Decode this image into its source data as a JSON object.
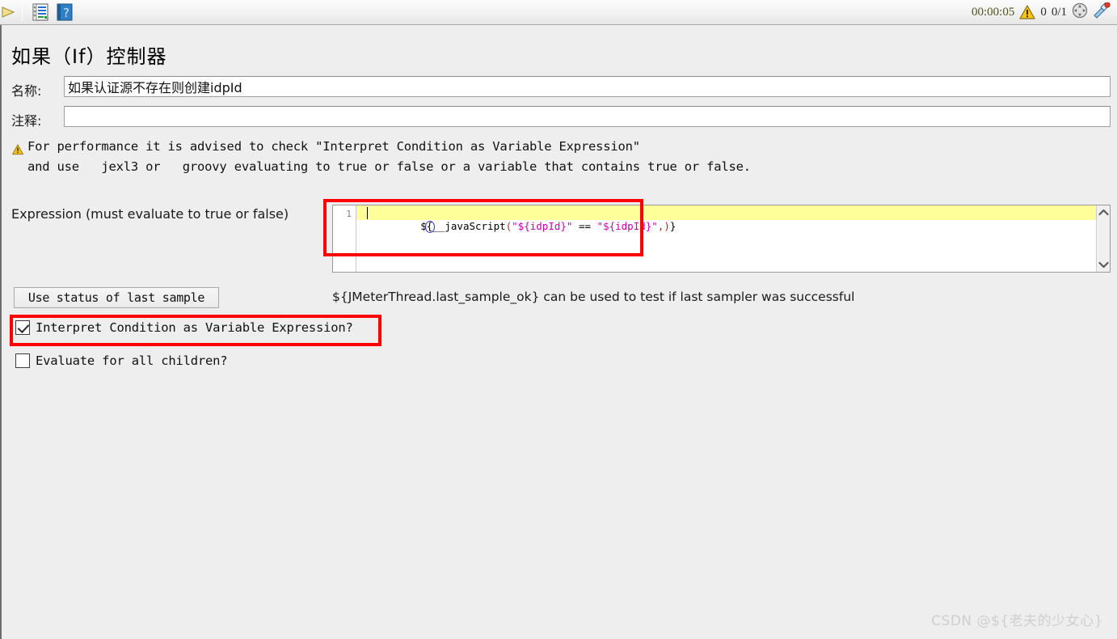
{
  "toolbar": {
    "icons": [
      {
        "name": "run-start-icon",
        "glyph": "start"
      },
      {
        "name": "function-helper-icon",
        "glyph": "notes"
      },
      {
        "name": "help-icon",
        "glyph": "question"
      }
    ],
    "elapsed_time": "00:00:05",
    "warning_count": "0",
    "thread_counts": "0/1",
    "warning_icon_name": "warning-triangle-icon",
    "clear_icon_name": "clear-all-icon",
    "brush_icon_name": "clear-gui-icon"
  },
  "page": {
    "title": "如果（If）控制器"
  },
  "form": {
    "name_label": "名称:",
    "name_value": "如果认证源不存在则创建idpId",
    "comment_label": "注释:",
    "comment_value": "",
    "comment_placeholder": ""
  },
  "warning": {
    "icon_name": "warning-triangle-icon",
    "line1": "For performance it is advised to check \"Interpret Condition as Variable Expression\"",
    "line2": "and use   jexl3 or   groovy evaluating to true or false or a variable that contains true or false."
  },
  "expression": {
    "label": "Expression (must evaluate to true or false)",
    "line_number": "1",
    "value": "${__javaScript(\"${idpId}\" == \"${idpId}\",)}",
    "tokens": [
      {
        "text": "$",
        "type": "plain"
      },
      {
        "text": "{",
        "type": "brace-match"
      },
      {
        "text": "__javaScript",
        "type": "fn"
      },
      {
        "text": "(",
        "type": "paren"
      },
      {
        "text": "\"${idpId}\"",
        "type": "str"
      },
      {
        "text": " == ",
        "type": "plain"
      },
      {
        "text": "\"${idpId}\"",
        "type": "str"
      },
      {
        "text": ",",
        "type": "paren"
      },
      {
        "text": ")",
        "type": "paren"
      },
      {
        "text": "}",
        "type": "plain"
      }
    ],
    "scroll_up_icon": "chevron-up-icon",
    "scroll_down_icon": "chevron-down-icon"
  },
  "actions": {
    "use_last_sample_status": "Use status of last sample",
    "hint": "${JMeterThread.last_sample_ok} can be used to test if last sampler was successful"
  },
  "options": [
    {
      "name": "interpret-condition-as-variable-expression",
      "label": "Interpret Condition as Variable Expression?",
      "checked": true
    },
    {
      "name": "evaluate-for-all-children",
      "label": "Evaluate for all children?",
      "checked": false
    }
  ],
  "annotations": {
    "highlight_color": "#ff0000"
  },
  "watermark": {
    "text": "CSDN @${老夫的少女心}"
  }
}
